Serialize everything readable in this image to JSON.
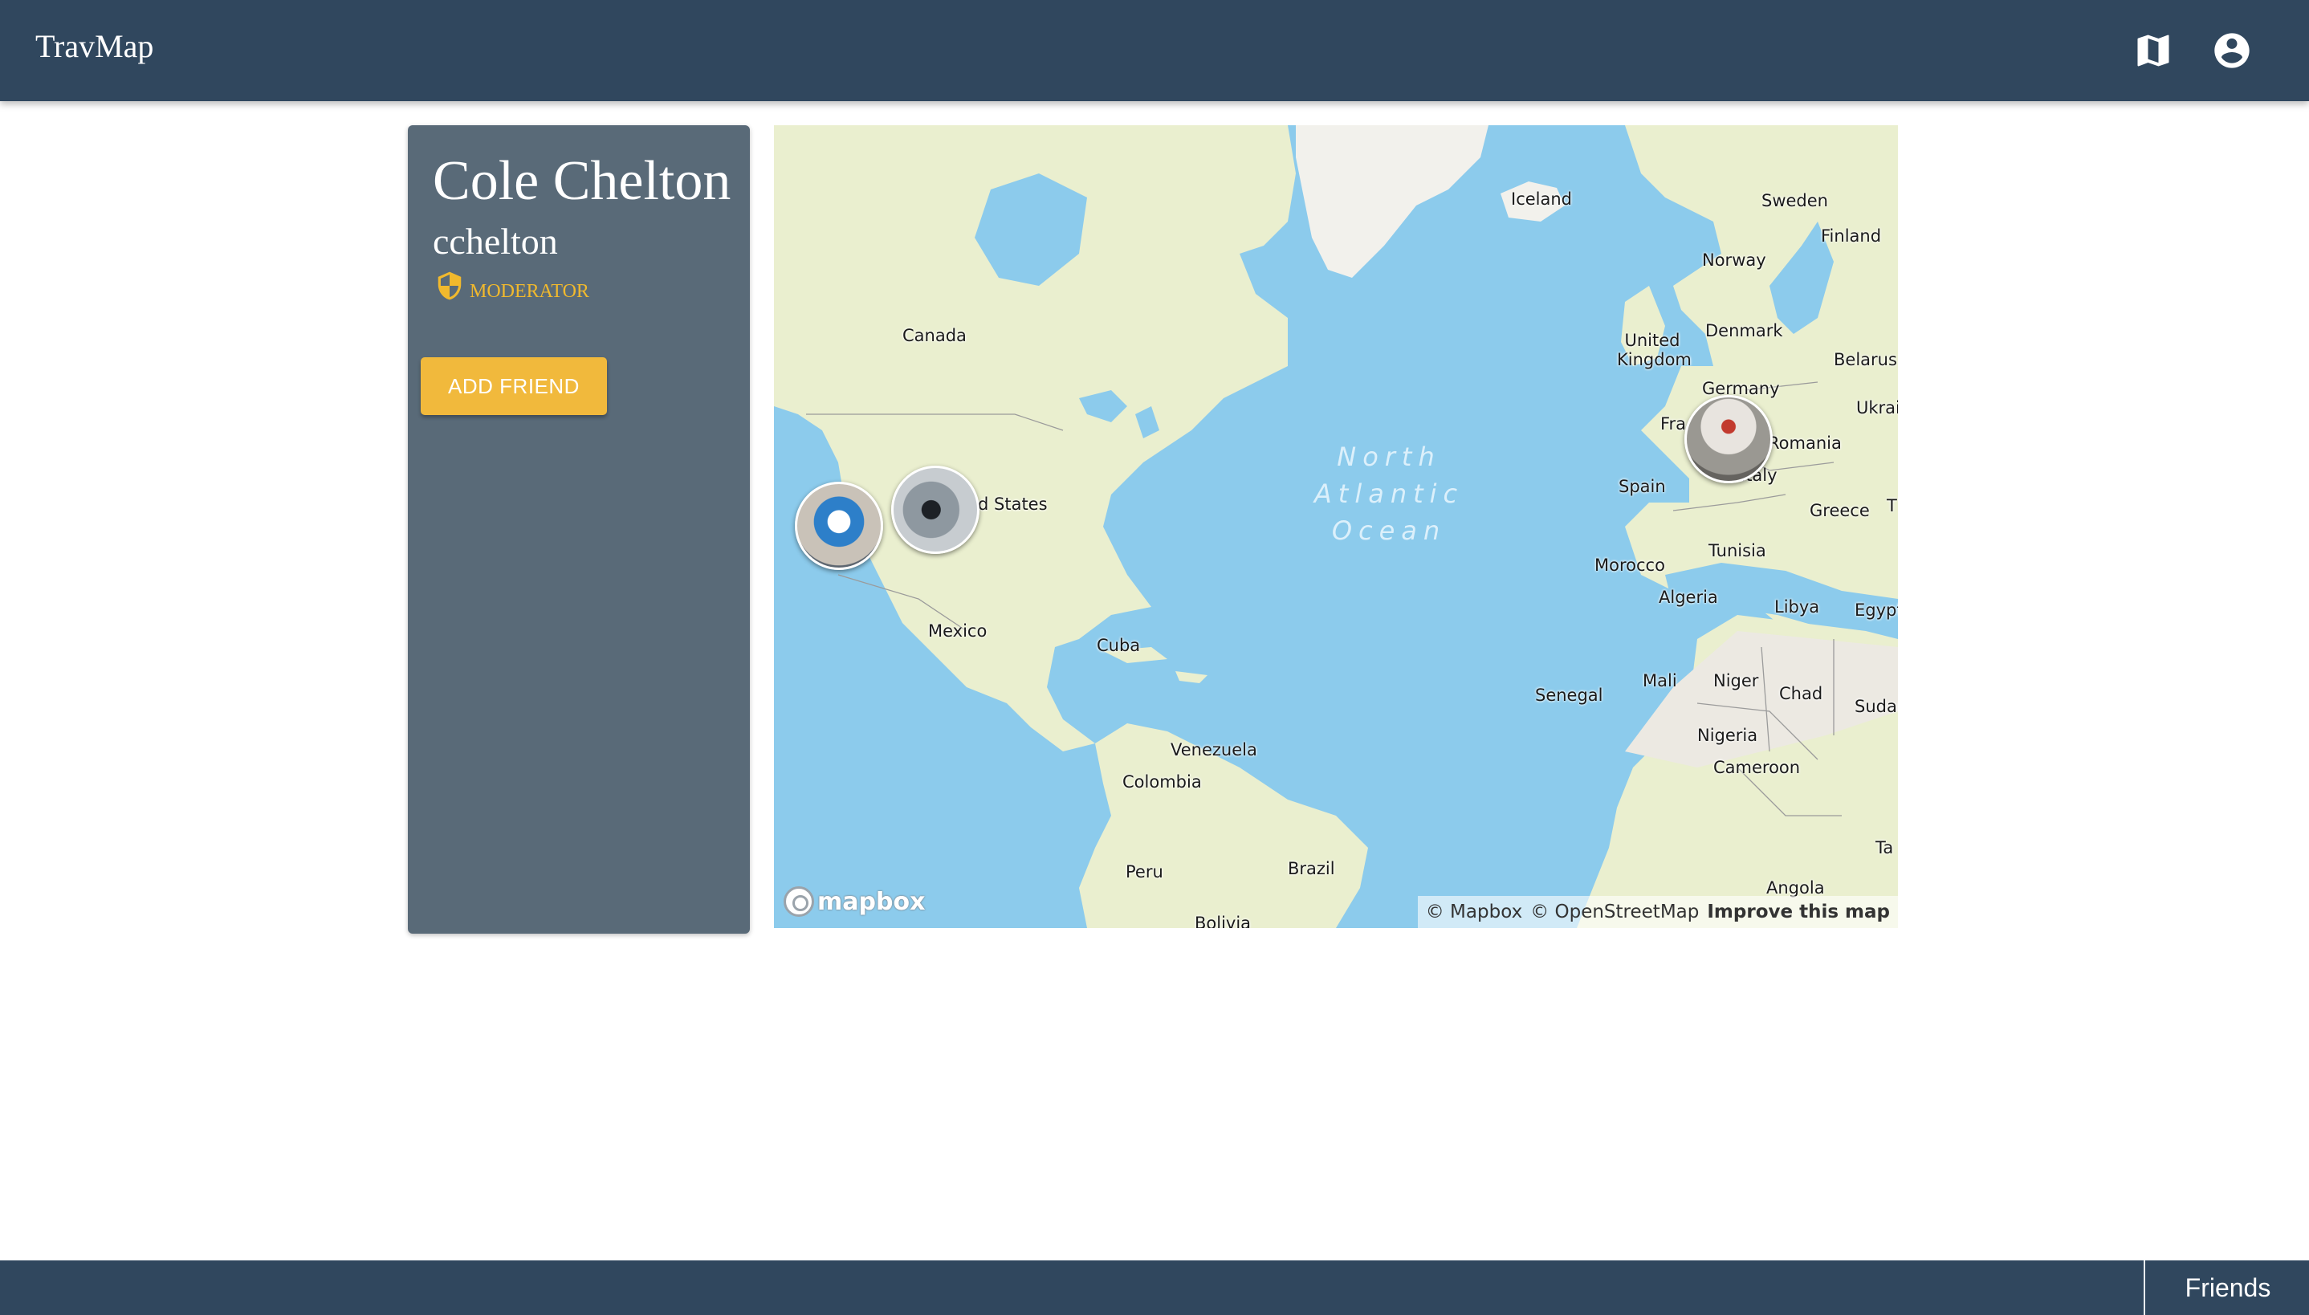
{
  "app": {
    "title": "TravMap"
  },
  "nav": {
    "icons": [
      "map-icon",
      "account-circle-icon"
    ]
  },
  "profile": {
    "full_name": "Cole Chelton",
    "username": "cchelton",
    "role_icon": "shield-icon",
    "role": "MODERATOR",
    "add_friend_label": "ADD FRIEND"
  },
  "map": {
    "ocean_label": [
      "North",
      "Atlantic",
      "Ocean"
    ],
    "countries": [
      "Iceland",
      "Sweden",
      "Finland",
      "Norway",
      "Canada",
      "United Kingdom",
      "Denmark",
      "Belarus",
      "Germany",
      "Ukrai",
      "Fra",
      "Romania",
      "Italy",
      "Spain",
      "Greece",
      "T",
      "d States",
      "Tunisia",
      "Morocco",
      "Algeria",
      "Libya",
      "Egypt",
      "Mexico",
      "Cuba",
      "Senegal",
      "Mali",
      "Niger",
      "Chad",
      "Sudar",
      "Nigeria",
      "Cameroon",
      "Venezuela",
      "Colombia",
      "Brazil",
      "Peru",
      "Bolivia",
      "Ta",
      "Angola"
    ],
    "markers": [
      "photo-marker-california",
      "photo-marker-western-us",
      "photo-marker-italy"
    ],
    "logo_text": "mapbox",
    "attribution": [
      "© Mapbox",
      "© OpenStreetMap",
      "Improve this map"
    ]
  },
  "footer": {
    "friends_label": "Friends"
  },
  "colors": {
    "header_bg": "#30475e",
    "card_bg": "#596a78",
    "accent": "#f1b93c",
    "water": "#8ccbec",
    "land": "#eaefcf"
  }
}
